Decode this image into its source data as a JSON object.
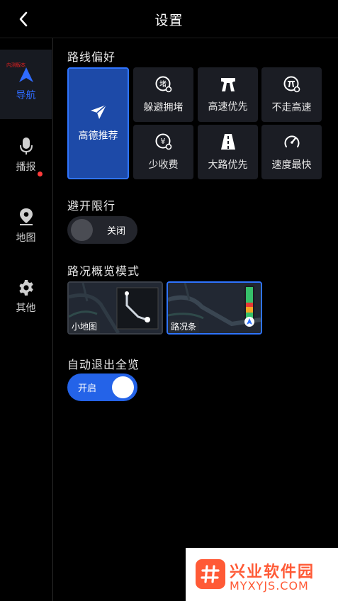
{
  "header": {
    "title": "设置"
  },
  "sidebar": {
    "items": [
      {
        "label": "导航",
        "tag": "内测版本",
        "active": true
      },
      {
        "label": "播报"
      },
      {
        "label": "地图",
        "badge": true
      },
      {
        "label": "其他"
      }
    ]
  },
  "route_pref": {
    "title": "路线偏好",
    "options": [
      {
        "label": "高德推荐",
        "selected": true
      },
      {
        "label": "躲避拥堵"
      },
      {
        "label": "高速优先"
      },
      {
        "label": "不走高速"
      },
      {
        "label": "少收费"
      },
      {
        "label": "大路优先"
      },
      {
        "label": "速度最快"
      }
    ]
  },
  "restriction": {
    "title": "避开限行",
    "toggle_label": "关闭",
    "enabled": false
  },
  "overview_mode": {
    "title": "路况概览模式",
    "options": [
      {
        "label": "小地图",
        "selected": false
      },
      {
        "label": "路况条",
        "selected": true
      }
    ]
  },
  "auto_exit": {
    "title": "自动退出全览",
    "toggle_label": "开启",
    "enabled": true
  },
  "watermark": {
    "name": "兴业软件园",
    "domain": "MYXYJS.COM"
  },
  "colors": {
    "accent": "#2f74ff",
    "selected_bg": "#1d4aa8",
    "tile_bg": "#1b1d24",
    "badge": "#ff3b3b"
  }
}
